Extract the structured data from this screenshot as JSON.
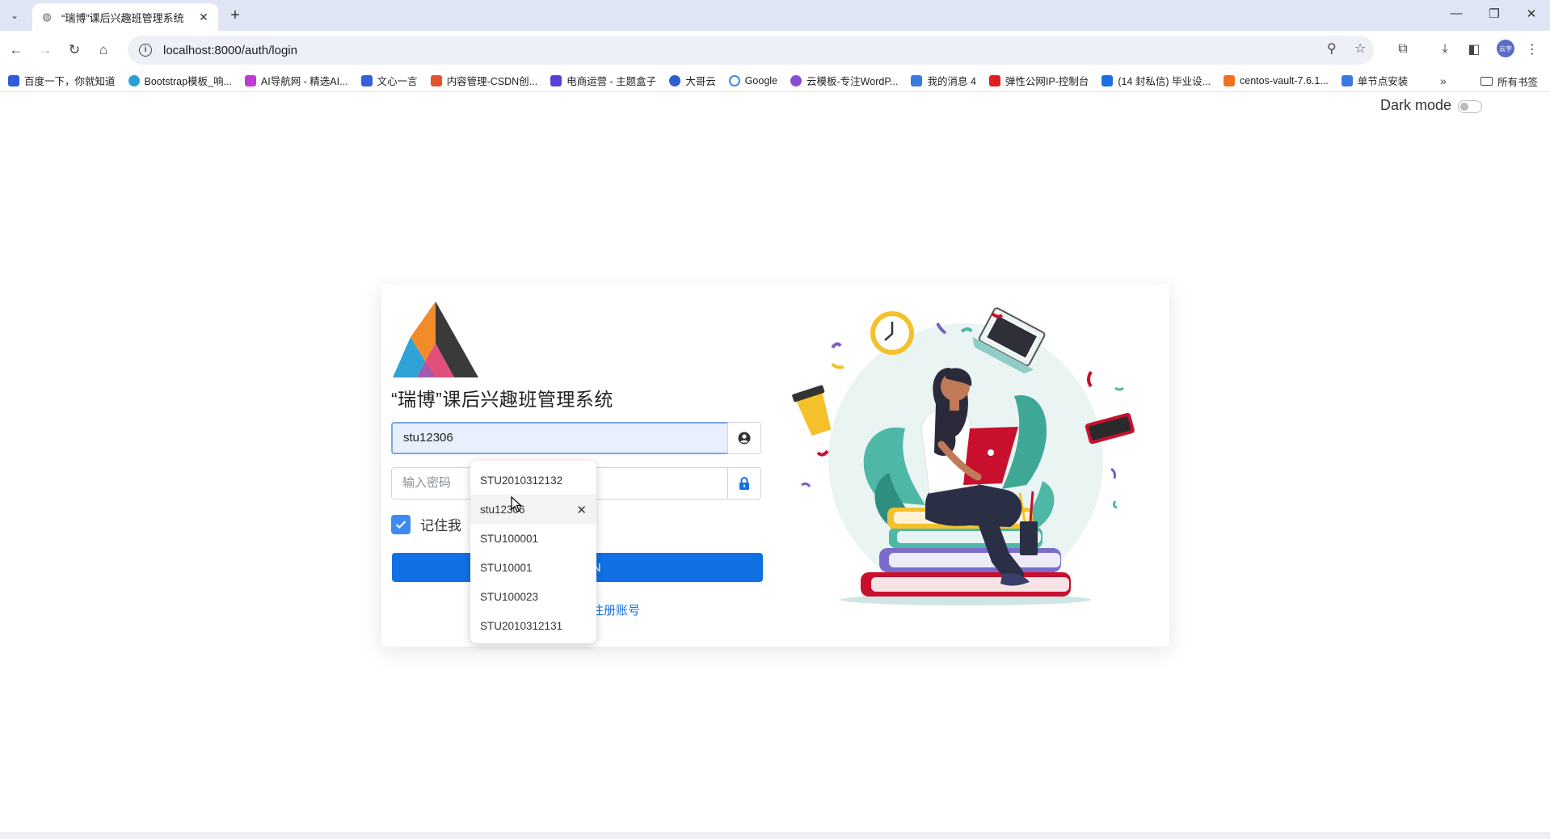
{
  "browser": {
    "tab_title": "“瑞博”课后兴趣班管理系统",
    "url": "localhost:8000/auth/login",
    "bookmarks": [
      {
        "label": "百度一下，你就知道",
        "color": "#2e5bd9"
      },
      {
        "label": "Bootstrap模板_响...",
        "color": "#2aa0d8"
      },
      {
        "label": "AI导航网 - 精选AI...",
        "color": "#c03bd6"
      },
      {
        "label": "文心一言",
        "color": "#3860d6"
      },
      {
        "label": "内容管理-CSDN创...",
        "color": "#e4542c"
      },
      {
        "label": "电商运营 - 主题盒子",
        "color": "#5a3fd6"
      },
      {
        "label": "大哥云",
        "color": "#2c5fd1"
      },
      {
        "label": "Google",
        "color": "#4285f4"
      },
      {
        "label": "云模板-专注WordP...",
        "color": "#8a4cd6"
      },
      {
        "label": "我的消息 4",
        "color": "#3a79e0"
      },
      {
        "label": "弹性公网IP-控制台",
        "color": "#e02020"
      },
      {
        "label": "(14 封私信) 毕业设...",
        "color": "#1b6fe0"
      },
      {
        "label": "centos-vault-7.6.1...",
        "color": "#f07020"
      },
      {
        "label": "单节点安装",
        "color": "#3a7ae0"
      }
    ],
    "bookmarks_folder": "所有书签",
    "profile_initials": "云宇"
  },
  "page": {
    "dark_mode_label": "Dark mode",
    "app_title": "“瑞博”课后兴趣班管理系统",
    "username_value": "stu12306",
    "password_placeholder": "输入密码",
    "remember_label": "记住我",
    "signin_label": "SIGN IN",
    "register_label": "注册账号"
  },
  "autocomplete": {
    "items": [
      "STU2010312132",
      "stu12306",
      "STU100001",
      "STU10001",
      "STU100023",
      "STU2010312131"
    ],
    "hovered_index": 1
  },
  "colors": {
    "primary": "#1170e4",
    "checkbox": "#3d8bf0",
    "input_focus_bg": "#e8f0fe"
  }
}
